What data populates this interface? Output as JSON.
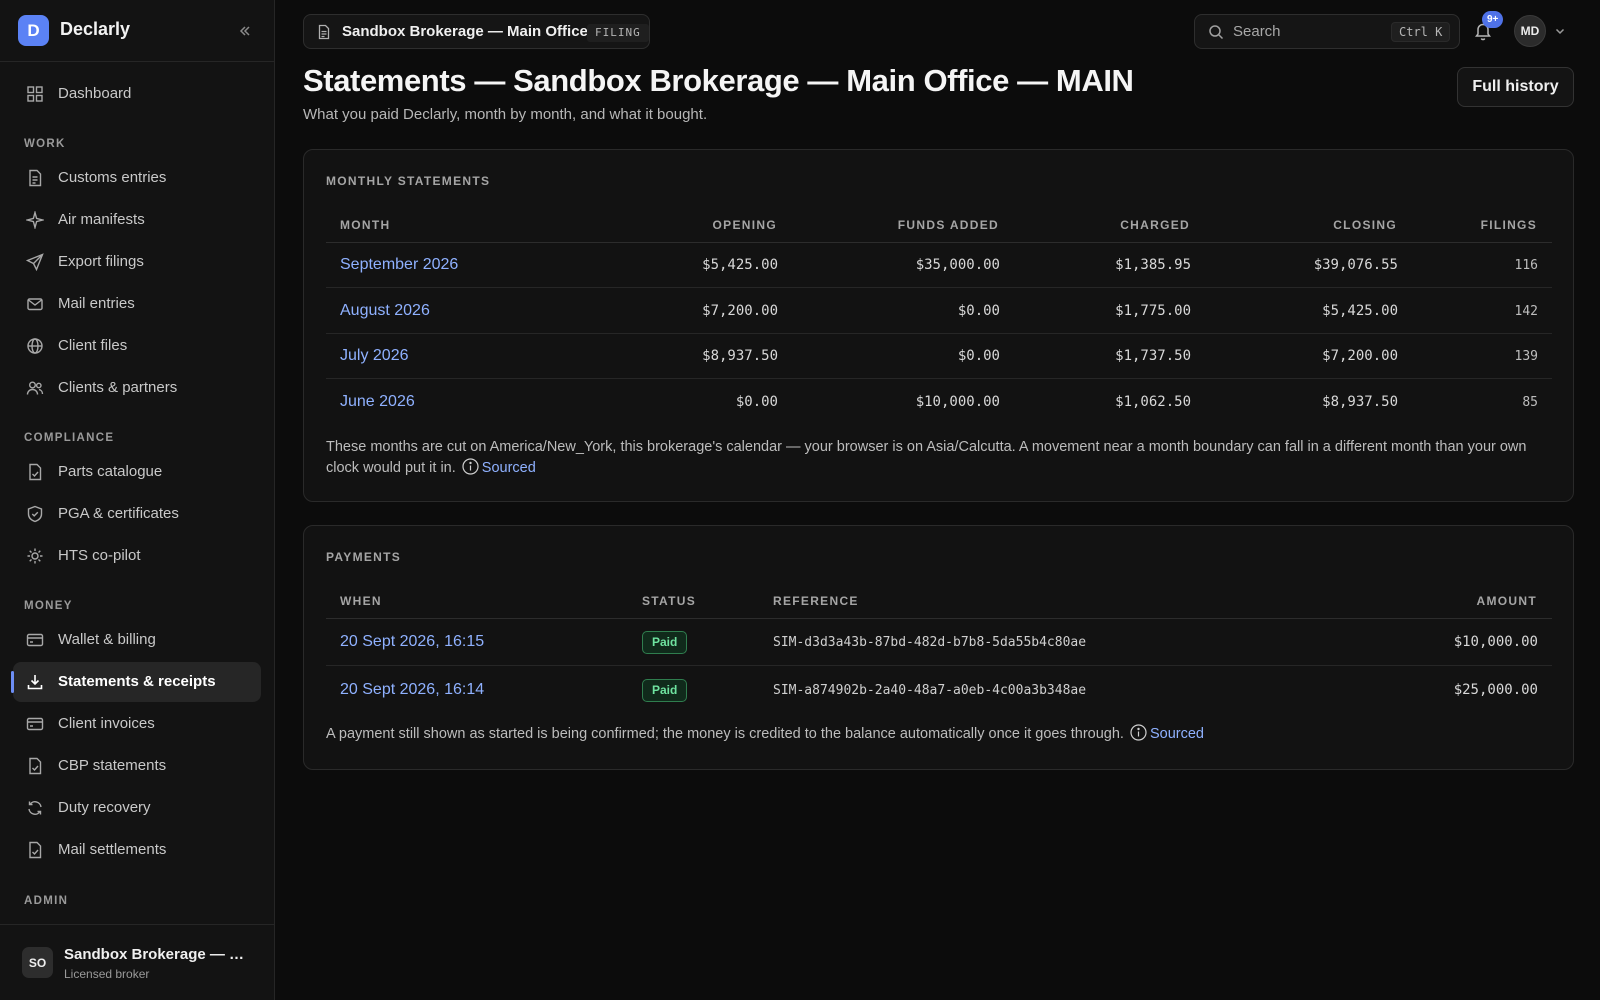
{
  "brand": {
    "logo_letter": "D",
    "name": "Declarly"
  },
  "sidebar": {
    "dashboard": "Dashboard",
    "sections": {
      "work": "WORK",
      "compliance": "COMPLIANCE",
      "money": "MONEY",
      "admin": "ADMIN"
    },
    "work": [
      "Customs entries",
      "Air manifests",
      "Export filings",
      "Mail entries",
      "Client files",
      "Clients & partners"
    ],
    "compliance": [
      "Parts catalogue",
      "PGA & certificates",
      "HTS co-pilot"
    ],
    "money": [
      "Wallet & billing",
      "Statements & receipts",
      "Client invoices",
      "CBP statements",
      "Duty recovery",
      "Mail settlements"
    ],
    "active_item": "Statements & receipts",
    "account": {
      "initials": "SO",
      "name": "Sandbox Brokerage — Main Office",
      "role": "Licensed broker"
    }
  },
  "topbar": {
    "office_name": "Sandbox Brokerage — Main Office",
    "office_tag": "FILING",
    "search_placeholder": "Search",
    "search_shortcut": "Ctrl K",
    "notifications_badge": "9+",
    "user_initials": "MD"
  },
  "header": {
    "title": "Statements — Sandbox Brokerage — Main Office — MAIN",
    "subtitle": "What you paid Declarly, month by month, and what it bought.",
    "full_history_label": "Full history"
  },
  "monthly": {
    "title": "MONTHLY STATEMENTS",
    "columns": [
      "MONTH",
      "OPENING",
      "FUNDS ADDED",
      "CHARGED",
      "CLOSING",
      "FILINGS"
    ],
    "rows": [
      [
        "September 2026",
        "$5,425.00",
        "$35,000.00",
        "$1,385.95",
        "$39,076.55",
        "116"
      ],
      [
        "August 2026",
        "$7,200.00",
        "$0.00",
        "$1,775.00",
        "$5,425.00",
        "142"
      ],
      [
        "July 2026",
        "$8,937.50",
        "$0.00",
        "$1,737.50",
        "$7,200.00",
        "139"
      ],
      [
        "June 2026",
        "$0.00",
        "$10,000.00",
        "$1,062.50",
        "$8,937.50",
        "85"
      ]
    ],
    "note": "These months are cut on America/New_York, this brokerage's calendar — your browser is on Asia/Calcutta. A movement near a month boundary can fall in a different month than your own clock would put it in.",
    "sourced_label": "Sourced"
  },
  "payments": {
    "title": "PAYMENTS",
    "columns": [
      "WHEN",
      "STATUS",
      "REFERENCE",
      "AMOUNT"
    ],
    "rows": [
      [
        "20 Sept 2026, 16:15",
        "Paid",
        "SIM-d3d3a43b-87bd-482d-b7b8-5da55b4c80ae",
        "$10,000.00"
      ],
      [
        "20 Sept 2026, 16:14",
        "Paid",
        "SIM-a874902b-2a40-48a7-a0eb-4c00a3b348ae",
        "$25,000.00"
      ]
    ],
    "note": "A payment still shown as started is being confirmed; the money is credited to the balance automatically once it goes through.",
    "sourced_label": "Sourced"
  },
  "colors": {
    "accent": "#5b82f5",
    "link": "#8fb1ff",
    "paid": "#6fe3a0"
  }
}
